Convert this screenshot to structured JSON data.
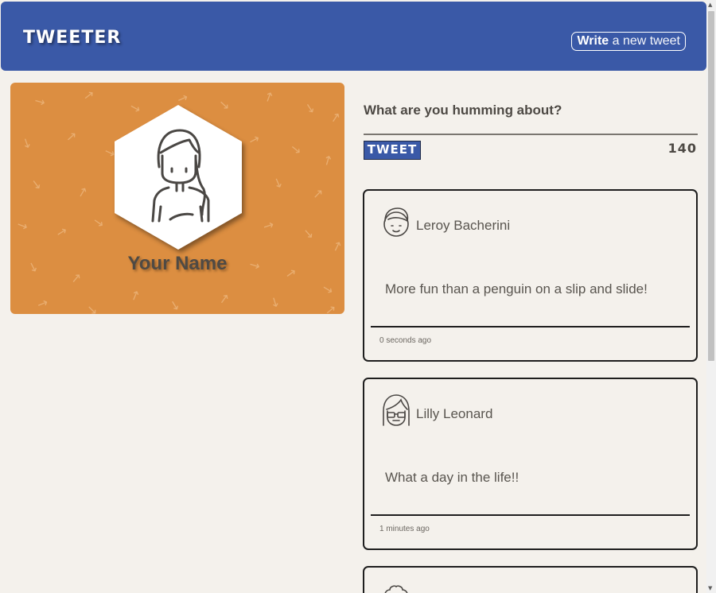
{
  "nav": {
    "brand": "TWEETER",
    "compose_bold": "Write",
    "compose_rest": " a new tweet"
  },
  "profile": {
    "name": "Your Name",
    "bg_color": "#dc8e41"
  },
  "composer": {
    "prompt": "What are you humming about?",
    "tweet_button": "TWEET",
    "counter": "140"
  },
  "tweets": [
    {
      "author": "Leroy Bacherini",
      "content": "More fun than a penguin on a slip and slide!",
      "time": "0 seconds ago",
      "avatar_icon": "boy-avatar-icon"
    },
    {
      "author": "Lilly Leonard",
      "content": "What a day in the life!!",
      "time": "1 minutes ago",
      "avatar_icon": "girl-glasses-avatar-icon"
    }
  ],
  "colors": {
    "nav": "#3a59a7",
    "background": "#f4f1ec",
    "profile": "#dc8e41"
  }
}
